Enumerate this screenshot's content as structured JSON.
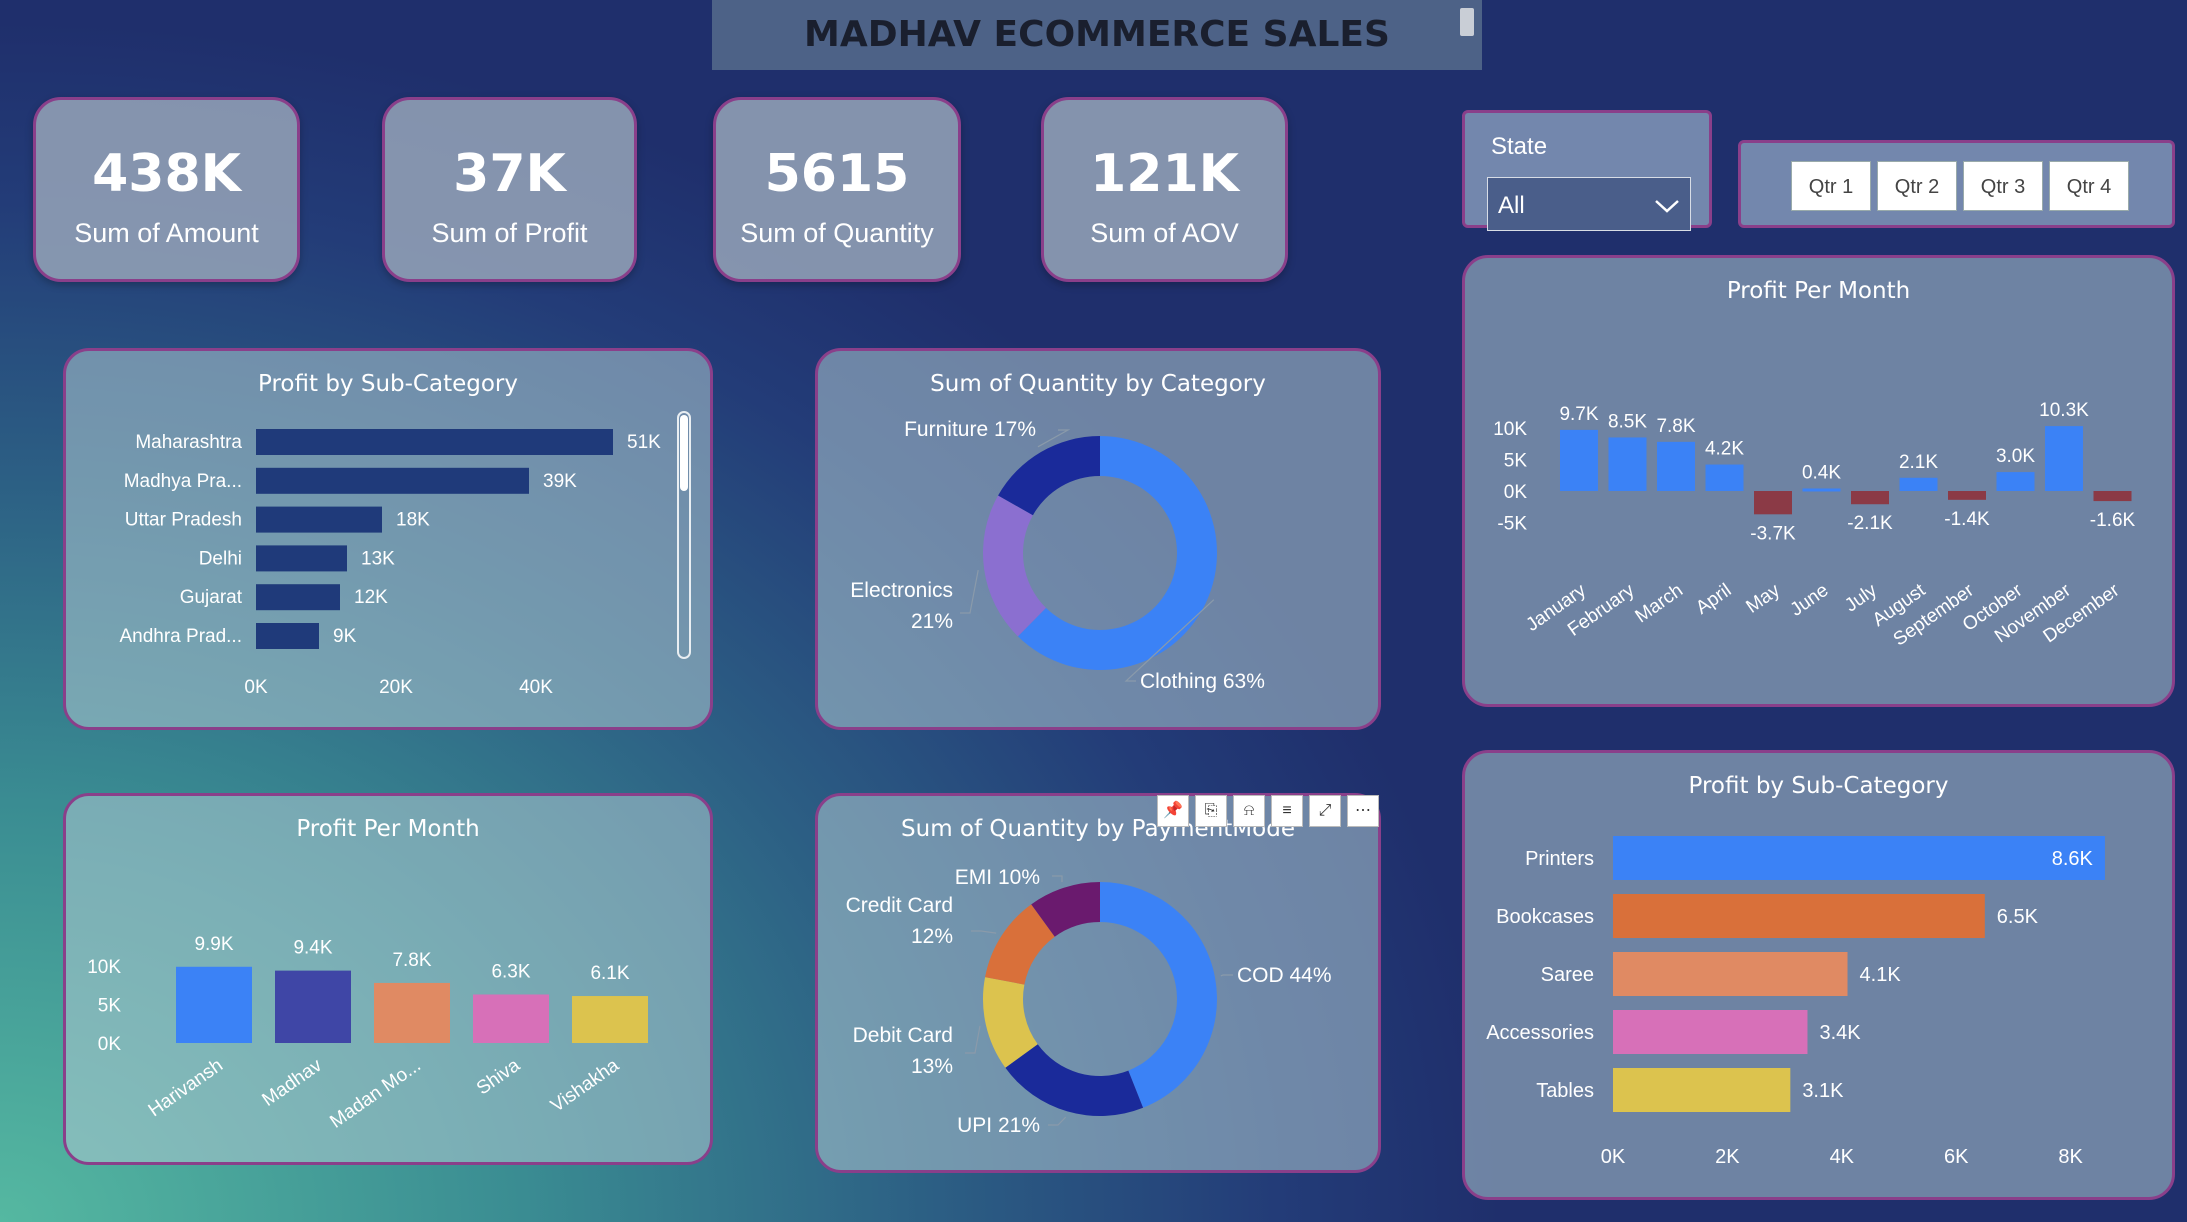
{
  "title": "MADHAV ECOMMERCE SALES",
  "kpis": [
    {
      "value": "438K",
      "label": "Sum of Amount"
    },
    {
      "value": "37K",
      "label": "Sum of Profit"
    },
    {
      "value": "5615",
      "label": "Sum of Quantity"
    },
    {
      "value": "121K",
      "label": "Sum of AOV"
    }
  ],
  "filters": {
    "state_label": "State",
    "state_value": "All",
    "quarters": [
      "Qtr 1",
      "Qtr 2",
      "Qtr 3",
      "Qtr 4"
    ]
  },
  "visual_toolbar": {
    "icons": [
      "pin-icon",
      "copy-icon",
      "bell-icon",
      "filter-icon",
      "focus-mode-icon",
      "more-options-icon"
    ]
  },
  "chart_data": [
    {
      "id": "state-profit",
      "type": "bar",
      "orientation": "horizontal",
      "title": "Profit by Sub-Category",
      "categories": [
        "Maharashtra",
        "Madhya Pra...",
        "Uttar Pradesh",
        "Delhi",
        "Gujarat",
        "Andhra Prad..."
      ],
      "values": [
        51,
        39,
        18,
        13,
        12,
        9
      ],
      "data_labels": [
        "51K",
        "39K",
        "18K",
        "13K",
        "12K",
        "9K"
      ],
      "x_ticks": [
        "0K",
        "20K",
        "40K"
      ],
      "xlim": [
        0,
        55
      ],
      "color": "#1f3a7a"
    },
    {
      "id": "qty-category",
      "type": "pie",
      "donut": true,
      "title": "Sum of Quantity by Category",
      "categories": [
        "Clothing",
        "Electronics",
        "Furniture"
      ],
      "values": [
        63,
        21,
        17
      ],
      "labels": [
        [
          "Clothing 63%"
        ],
        [
          "Electronics",
          "21%"
        ],
        [
          "Furniture 17%"
        ]
      ],
      "colors": [
        "#3b82f6",
        "#8b6fd0",
        "#1a2a9a"
      ]
    },
    {
      "id": "profit-month-main",
      "type": "bar",
      "title": "Profit Per Month",
      "categories": [
        "January",
        "February",
        "March",
        "April",
        "May",
        "June",
        "July",
        "August",
        "September",
        "October",
        "November",
        "December"
      ],
      "values": [
        9.7,
        8.5,
        7.8,
        4.2,
        -3.7,
        0.4,
        -2.1,
        2.1,
        -1.4,
        3.0,
        10.3,
        -1.6
      ],
      "data_labels": [
        "9.7K",
        "8.5K",
        "7.8K",
        "4.2K",
        "-3.7K",
        "0.4K",
        "-2.1K",
        "2.1K",
        "-1.4K",
        "3.0K",
        "10.3K",
        "-1.6K"
      ],
      "y_ticks": [
        "10K",
        "5K",
        "0K",
        "-5K"
      ],
      "y_tick_values": [
        10,
        5,
        0,
        -5
      ],
      "ylim": [
        -5,
        10
      ],
      "colors": {
        "positive": "#3b82f6",
        "negative": "#8b3a46"
      }
    },
    {
      "id": "profit-person",
      "type": "bar",
      "title": "Profit Per Month",
      "categories": [
        "Harivansh",
        "Madhav",
        "Madan Mo...",
        "Shiva",
        "Vishakha"
      ],
      "values": [
        9.9,
        9.4,
        7.8,
        6.3,
        6.1
      ],
      "data_labels": [
        "9.9K",
        "9.4K",
        "7.8K",
        "6.3K",
        "6.1K"
      ],
      "y_ticks": [
        "10K",
        "5K",
        "0K"
      ],
      "y_tick_values": [
        10,
        5,
        0
      ],
      "ylim": [
        0,
        10
      ],
      "colors": [
        "#3b82f6",
        "#3f46a6",
        "#e08a63",
        "#d770b8",
        "#dcc34e"
      ]
    },
    {
      "id": "qty-payment",
      "type": "pie",
      "donut": true,
      "title": "Sum of Quantity by PaymentMode",
      "categories": [
        "COD",
        "UPI",
        "Debit Card",
        "Credit Card",
        "EMI"
      ],
      "values": [
        44,
        21,
        13,
        12,
        10
      ],
      "labels": [
        [
          "COD 44%"
        ],
        [
          "UPI 21%"
        ],
        [
          "Debit Card",
          "13%"
        ],
        [
          "Credit Card",
          "12%"
        ],
        [
          "EMI 10%"
        ]
      ],
      "colors": [
        "#3b82f6",
        "#1a2a9a",
        "#dcc34e",
        "#d9703a",
        "#6a1a6e"
      ]
    },
    {
      "id": "subcat-profit",
      "type": "bar",
      "orientation": "horizontal",
      "title": "Profit by Sub-Category",
      "categories": [
        "Printers",
        "Bookcases",
        "Saree",
        "Accessories",
        "Tables"
      ],
      "values": [
        8.6,
        6.5,
        4.1,
        3.4,
        3.1
      ],
      "data_labels": [
        "8.6K",
        "6.5K",
        "4.1K",
        "3.4K",
        "3.1K"
      ],
      "x_ticks": [
        "0K",
        "2K",
        "4K",
        "6K",
        "8K"
      ],
      "x_tick_values": [
        0,
        2,
        4,
        6,
        8
      ],
      "xlim": [
        0,
        9
      ],
      "colors": [
        "#3b82f6",
        "#d9703a",
        "#e08a63",
        "#d770b8",
        "#dcc34e"
      ]
    }
  ]
}
